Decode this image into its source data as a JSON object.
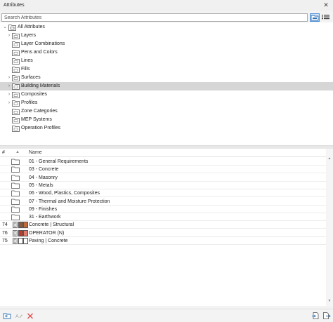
{
  "window": {
    "title": "Attributes",
    "close_glyph": "✕"
  },
  "search": {
    "placeholder": "Search Attributes"
  },
  "toolbar": {
    "folder_view_icon": "folder-view-icon",
    "list_view_icon": "list-view-icon"
  },
  "tree": {
    "root": {
      "label": "All Attributes",
      "expanded": true
    },
    "items": [
      {
        "label": "Layers",
        "expandable": true,
        "selected": false
      },
      {
        "label": "Layer Combinations",
        "expandable": false,
        "selected": false
      },
      {
        "label": "Pens and Colors",
        "expandable": false,
        "selected": false
      },
      {
        "label": "Lines",
        "expandable": false,
        "selected": false
      },
      {
        "label": "Fills",
        "expandable": false,
        "selected": false
      },
      {
        "label": "Surfaces",
        "expandable": true,
        "selected": false
      },
      {
        "label": "Building Materials",
        "expandable": true,
        "selected": true
      },
      {
        "label": "Composites",
        "expandable": true,
        "selected": false
      },
      {
        "label": "Profiles",
        "expandable": true,
        "selected": false
      },
      {
        "label": "Zone Categories",
        "expandable": false,
        "selected": false
      },
      {
        "label": "MEP Systems",
        "expandable": false,
        "selected": false
      },
      {
        "label": "Operation Profiles",
        "expandable": false,
        "selected": false
      }
    ]
  },
  "table": {
    "headers": {
      "index": "#",
      "name": "Name"
    },
    "sort_glyph": "▲",
    "folders": [
      "01 - General Requirements",
      "03 - Concrete",
      "04 - Masonry",
      "05 - Metals",
      "06 - Wood, Plastics, Composites",
      "07 - Thermal and Moisture Protection",
      "09 - Finishes",
      "31 - Earthwork"
    ],
    "materials": [
      {
        "index": "74",
        "name": "Concrete | Structural",
        "colors": [
          "#8b5a3c",
          "#c46a3a"
        ]
      },
      {
        "index": "76",
        "name": "OPERATOR (N)",
        "colors": [
          "#c0392b",
          "#e07b6b"
        ]
      },
      {
        "index": "75",
        "name": "Paving | Concrete",
        "colors": [
          "#ffffff",
          "#ffffff"
        ]
      }
    ]
  },
  "footer": {
    "new_folder_icon": "new-folder-icon",
    "rename_icon": "rename-icon",
    "delete_icon": "delete-icon",
    "import_icon": "import-icon",
    "export_icon": "export-icon"
  },
  "colors": {
    "selection": "#d6d6d6",
    "accent": "#4a90d9",
    "delete": "#e04a4a"
  }
}
